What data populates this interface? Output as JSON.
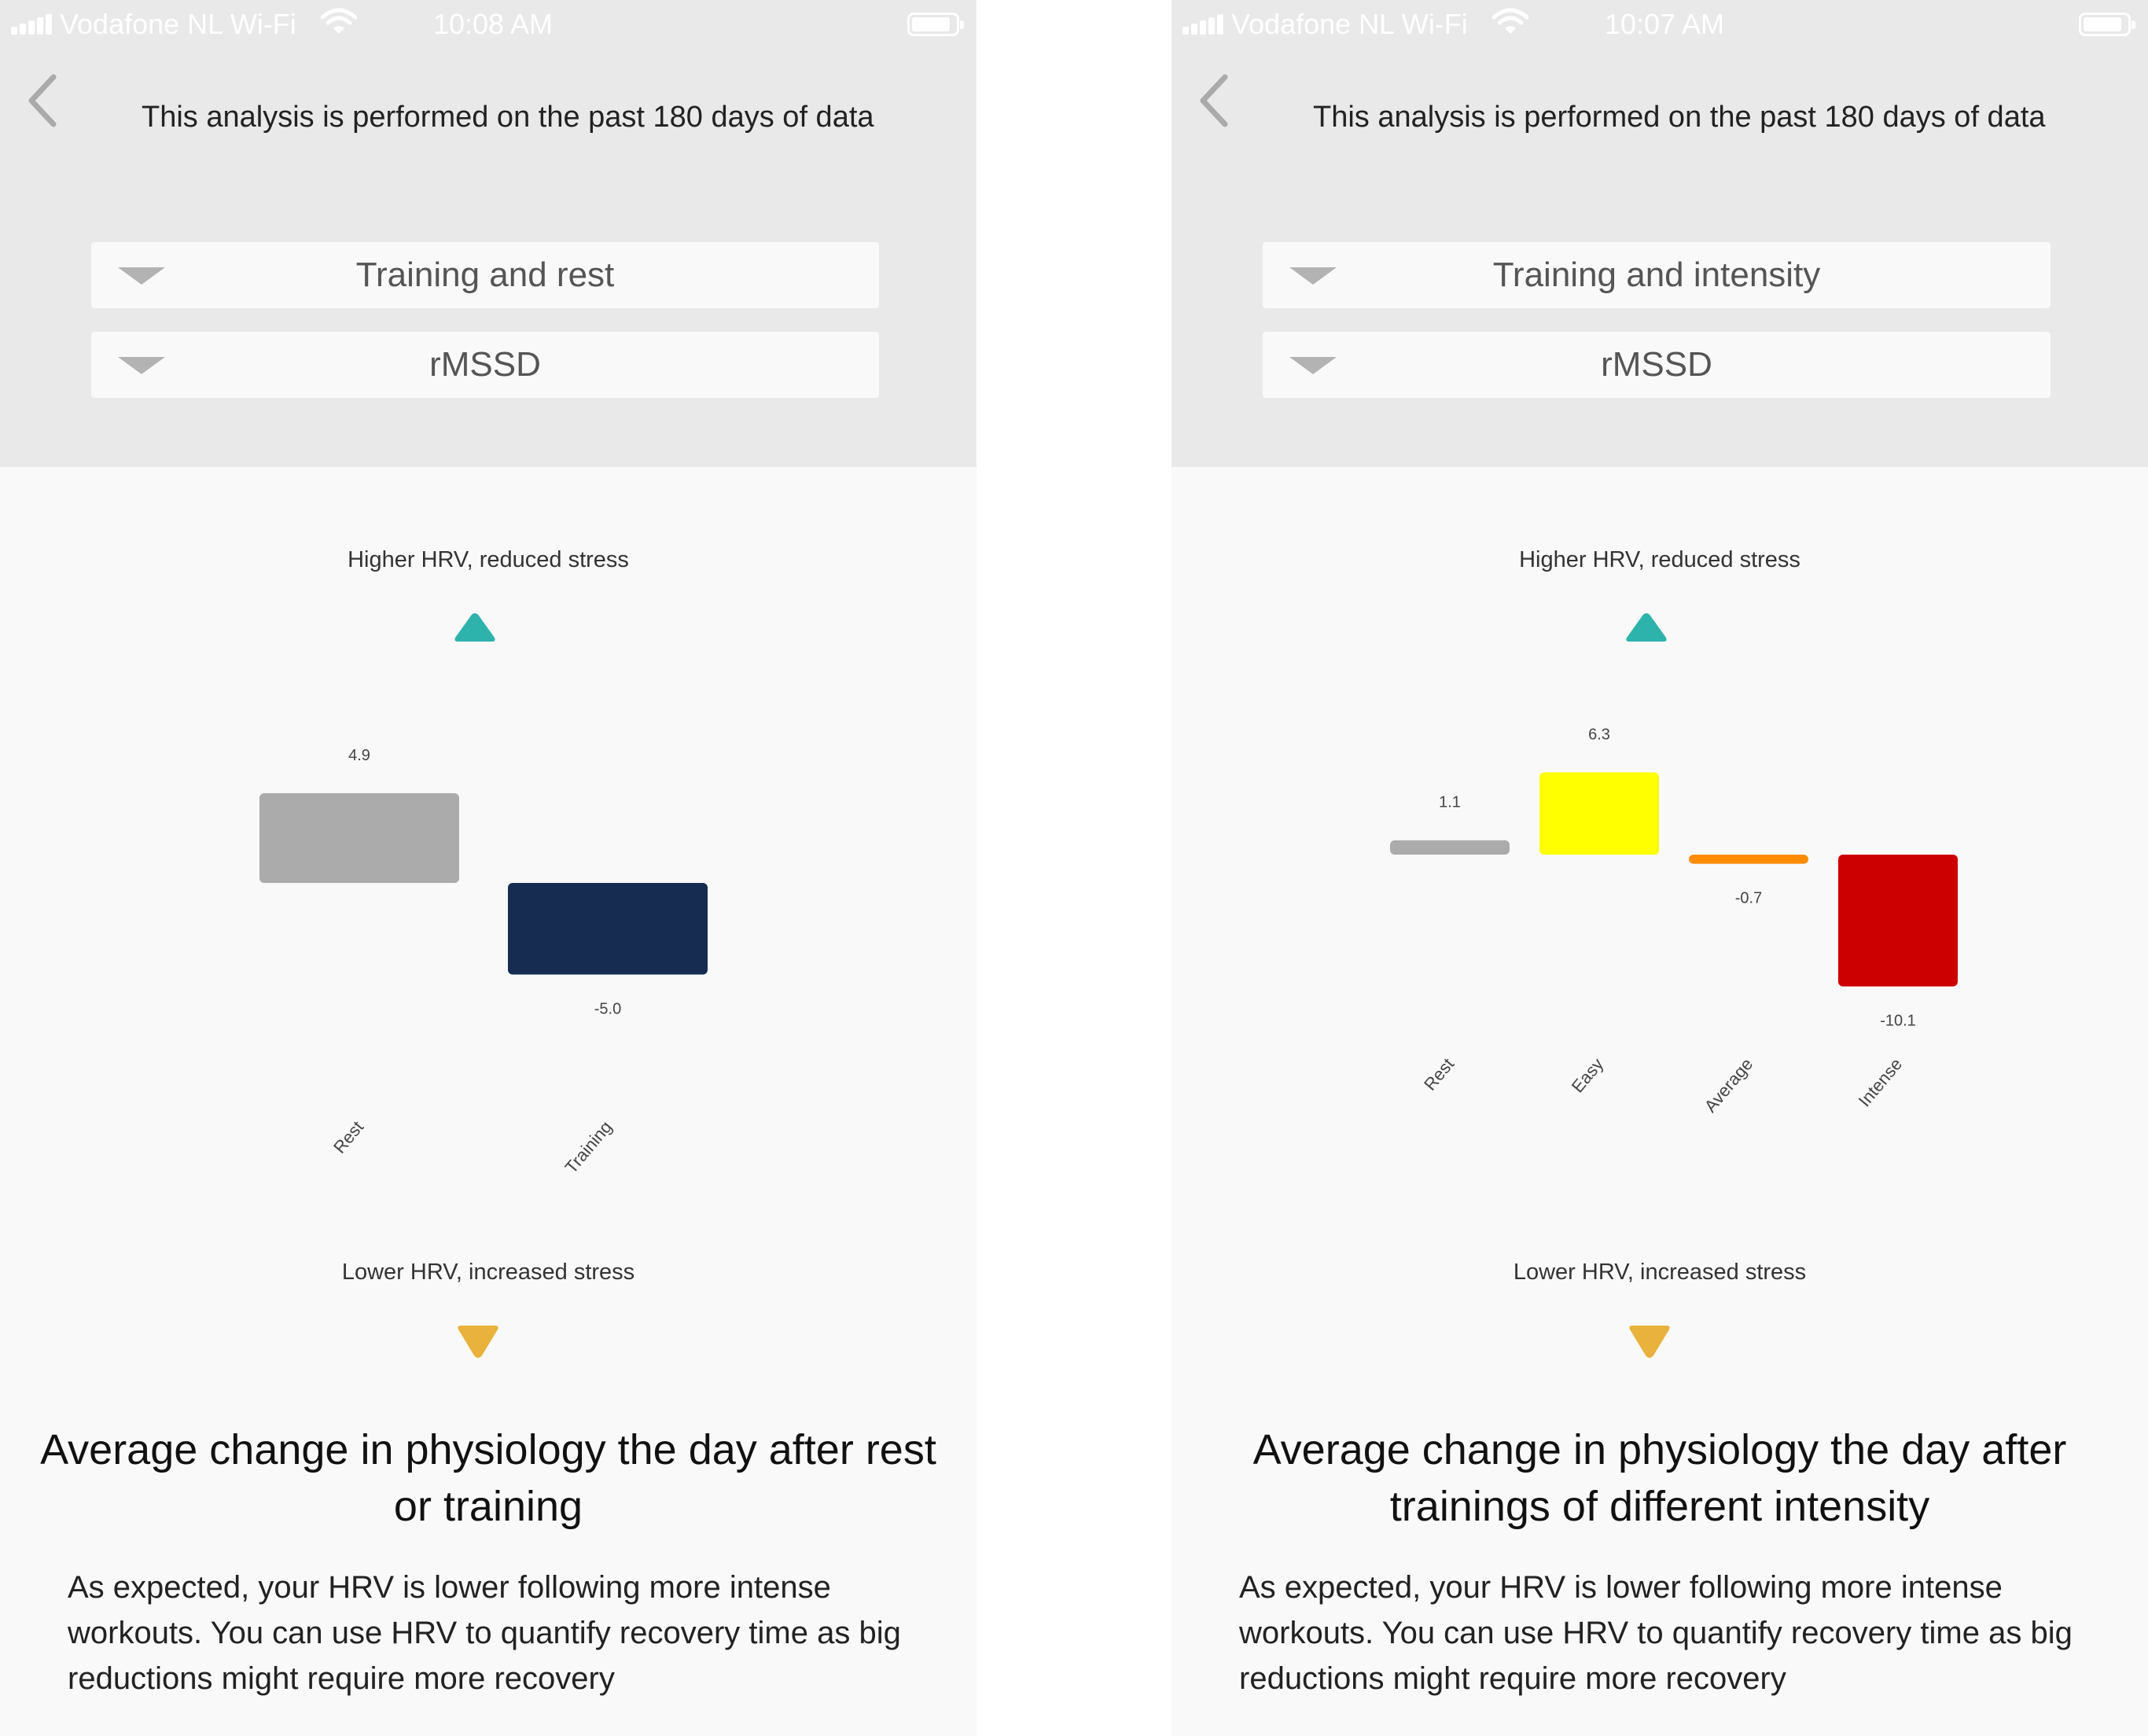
{
  "screens": [
    {
      "status_bar": {
        "carrier": "Vodafone NL Wi-Fi",
        "time": "10:08 AM"
      },
      "info_text": "This analysis is performed on the past 180 days of data",
      "dropdown_grouping": {
        "value": "Training and rest"
      },
      "dropdown_metric": {
        "value": "rMSSD"
      },
      "hint_up": "Higher HRV, reduced stress",
      "hint_down": "Lower HRV, increased stress",
      "title": "Average change in physiology the day after rest or training",
      "body": "As expected, your HRV is lower following more intense workouts. You can use HRV to quantify recovery time as big reductions might require more recovery"
    },
    {
      "status_bar": {
        "carrier": "Vodafone NL Wi-Fi",
        "time": "10:07 AM"
      },
      "info_text": "This analysis is performed on the past 180 days of data",
      "dropdown_grouping": {
        "value": "Training and intensity"
      },
      "dropdown_metric": {
        "value": "rMSSD"
      },
      "hint_up": "Higher HRV, reduced stress",
      "hint_down": "Lower HRV, increased stress",
      "title": "Average change in physiology the day after trainings of different intensity",
      "body": "As expected, your HRV is lower following more intense workouts. You can use HRV to quantify recovery time as big reductions might require more recovery"
    }
  ],
  "colors": {
    "accent_up": "#2eb3ac",
    "accent_down": "#e8b23c",
    "header_bg": "#e9e9e9",
    "content_bg": "#f9f9f9"
  },
  "icons": [
    "back-chevron-icon",
    "dropdown-arrow-icon",
    "triangle-up-icon",
    "triangle-down-icon",
    "wifi-icon",
    "battery-icon",
    "signal-icon"
  ],
  "chart_data": [
    {
      "type": "bar",
      "categories": [
        "Rest",
        "Training"
      ],
      "values": [
        4.9,
        -5.0
      ],
      "value_labels": [
        "4.9",
        "-5.0"
      ],
      "colors": [
        "#ababab",
        "#162c51"
      ],
      "ylim": [
        -5.0,
        5.0
      ]
    },
    {
      "type": "bar",
      "categories": [
        "Rest",
        "Easy",
        "Average",
        "Intense"
      ],
      "values": [
        1.1,
        6.3,
        -0.7,
        -10.1
      ],
      "value_labels": [
        "1.1",
        "6.3",
        "-0.7",
        "-10.1"
      ],
      "colors": [
        "#ababab",
        "#ffff00",
        "#ff8c00",
        "#cc0000"
      ],
      "ylim": [
        -10.1,
        6.3
      ]
    }
  ]
}
